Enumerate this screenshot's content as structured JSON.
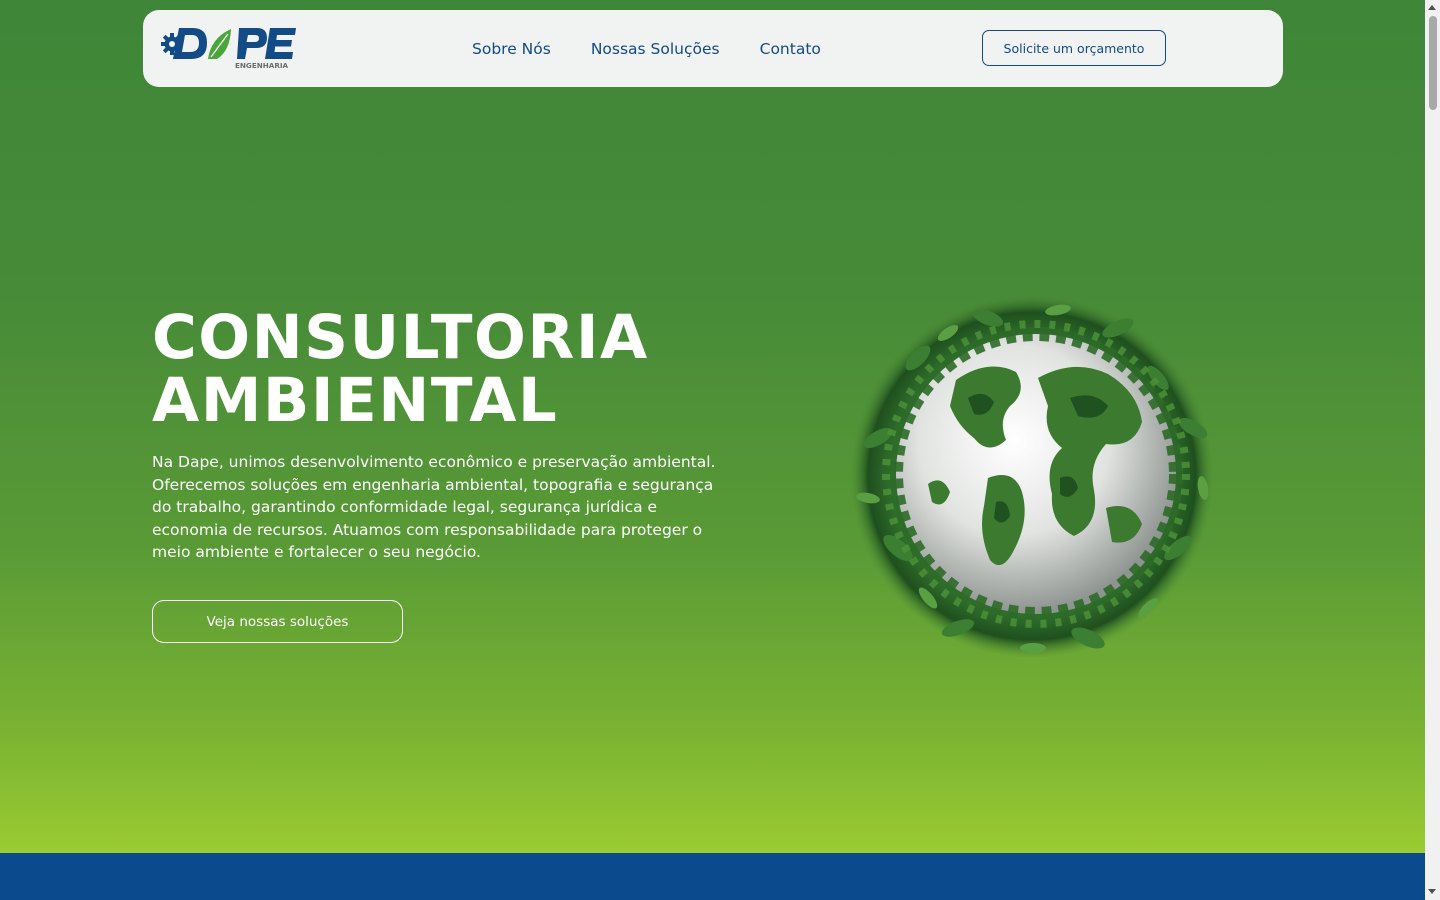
{
  "brand": {
    "name": "DAPE",
    "subtitle": "ENGENHARIA",
    "colors": {
      "blue": "#134b86",
      "green": "#4aa63a",
      "gray": "#6b6b6b"
    }
  },
  "nav": {
    "links": [
      "Sobre Nós",
      "Nossas Soluções",
      "Contato"
    ],
    "cta_label": "Solicite um orçamento"
  },
  "hero": {
    "title_line1": "CONSULTORIA",
    "title_line2": "AMBIENTAL",
    "description": "Na Dape, unimos desenvolvimento econômico e preservação ambiental. Oferecemos soluções em engenharia ambiental, topografia e segurança do trabalho, garantindo conformidade legal, segurança jurídica e economia de recursos. Atuamos com responsabilidade para proteger o meio ambiente e fortalecer o seu negócio.",
    "button_label": "Veja nossas soluções",
    "image_icon": "green-globe-illustration"
  },
  "colors": {
    "hero_top": "#3f8638",
    "hero_bottom": "#9acb31",
    "band": "#0b4a8c",
    "navbar_bg": "#f1f2f2"
  }
}
